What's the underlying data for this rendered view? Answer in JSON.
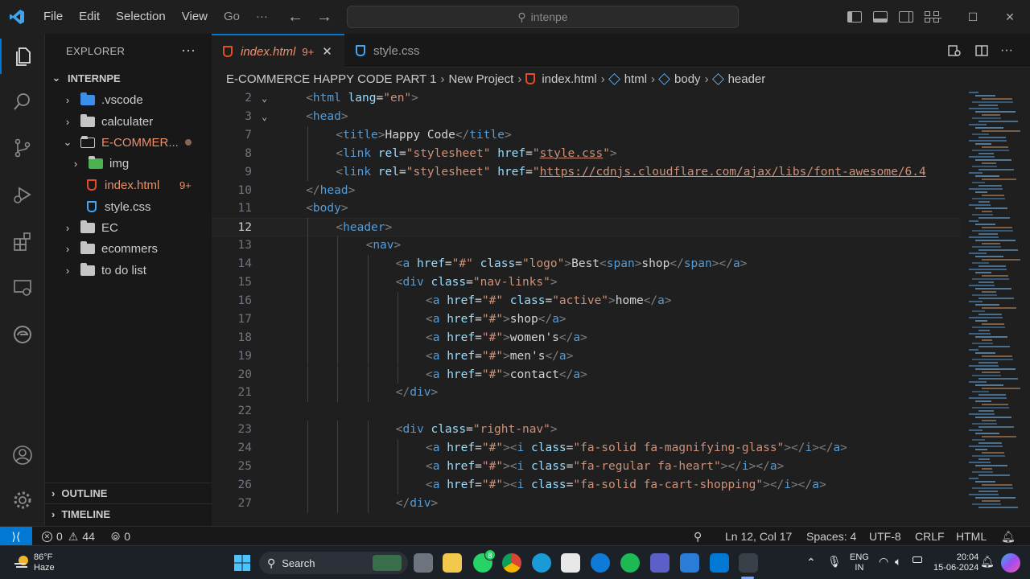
{
  "titlebar": {
    "menu": [
      "File",
      "Edit",
      "Selection",
      "View",
      "Go"
    ],
    "more": "···",
    "search_text": "intenpe"
  },
  "sidebar": {
    "title": "EXPLORER",
    "dots": "···",
    "root": "INTERNPE",
    "items": [
      {
        "label": ".vscode",
        "kind": "folder"
      },
      {
        "label": "calculater",
        "kind": "folder"
      },
      {
        "label": "E-COMMER...",
        "kind": "folder-open"
      },
      {
        "label": "img",
        "kind": "folder"
      },
      {
        "label": "index.html",
        "kind": "html",
        "badge": "9+"
      },
      {
        "label": "style.css",
        "kind": "css"
      },
      {
        "label": "EC",
        "kind": "folder"
      },
      {
        "label": "ecommers",
        "kind": "folder"
      },
      {
        "label": "to do list",
        "kind": "folder"
      }
    ],
    "outline": "OUTLINE",
    "timeline": "TIMELINE"
  },
  "tabs": [
    {
      "label": "index.html",
      "badge": "9+",
      "active": true
    },
    {
      "label": "style.css",
      "active": false
    }
  ],
  "breadcrumb": [
    "E-COMMERCE HAPPY CODE PART 1",
    "New Project",
    "index.html",
    "html",
    "body",
    "header"
  ],
  "editor": {
    "lines": [
      {
        "n": "2",
        "fold": "v",
        "parts": [
          [
            "br",
            "<"
          ],
          [
            "tag",
            "html"
          ],
          [
            "t",
            " "
          ],
          [
            "attr",
            "lang"
          ],
          [
            "t",
            "="
          ],
          [
            "val",
            "\"en\""
          ],
          [
            "br",
            ">"
          ]
        ],
        "indent": 1
      },
      {
        "n": "3",
        "fold": "v",
        "parts": [
          [
            "br",
            "<"
          ],
          [
            "tag",
            "head"
          ],
          [
            "br",
            ">"
          ]
        ],
        "indent": 1
      },
      {
        "n": "7",
        "parts": [
          [
            "br",
            "<"
          ],
          [
            "tag",
            "title"
          ],
          [
            "br",
            ">"
          ],
          [
            "t",
            "Happy Code"
          ],
          [
            "br",
            "</"
          ],
          [
            "tag",
            "title"
          ],
          [
            "br",
            ">"
          ]
        ],
        "indent": 2
      },
      {
        "n": "8",
        "parts": [
          [
            "br",
            "<"
          ],
          [
            "tag",
            "link"
          ],
          [
            "t",
            " "
          ],
          [
            "attr",
            "rel"
          ],
          [
            "t",
            "="
          ],
          [
            "val",
            "\"stylesheet\""
          ],
          [
            "t",
            " "
          ],
          [
            "attr",
            "href"
          ],
          [
            "t",
            "="
          ],
          [
            "val",
            "\""
          ],
          [
            "link",
            "style.css"
          ],
          [
            "val",
            "\""
          ],
          [
            "br",
            ">"
          ]
        ],
        "indent": 2
      },
      {
        "n": "9",
        "parts": [
          [
            "br",
            "<"
          ],
          [
            "tag",
            "link"
          ],
          [
            "t",
            " "
          ],
          [
            "attr",
            "rel"
          ],
          [
            "t",
            "="
          ],
          [
            "val",
            "\"stylesheet\""
          ],
          [
            "t",
            " "
          ],
          [
            "attr",
            "href"
          ],
          [
            "t",
            "="
          ],
          [
            "val",
            "\""
          ],
          [
            "link",
            "https://cdnjs.cloudflare.com/ajax/libs/font-awesome/6.4"
          ]
        ],
        "indent": 2
      },
      {
        "n": "10",
        "parts": [
          [
            "br",
            "</"
          ],
          [
            "tag",
            "head"
          ],
          [
            "br",
            ">"
          ]
        ],
        "indent": 1
      },
      {
        "n": "11",
        "parts": [
          [
            "br",
            "<"
          ],
          [
            "tag",
            "body"
          ],
          [
            "br",
            ">"
          ]
        ],
        "indent": 1
      },
      {
        "n": "12",
        "parts": [
          [
            "br",
            "<"
          ],
          [
            "tag",
            "header"
          ],
          [
            "br",
            ">"
          ]
        ],
        "indent": 2,
        "current": true
      },
      {
        "n": "13",
        "parts": [
          [
            "br",
            "<"
          ],
          [
            "tag",
            "nav"
          ],
          [
            "br",
            ">"
          ]
        ],
        "indent": 3
      },
      {
        "n": "14",
        "parts": [
          [
            "br",
            "<"
          ],
          [
            "tag",
            "a"
          ],
          [
            "t",
            " "
          ],
          [
            "attr",
            "href"
          ],
          [
            "t",
            "="
          ],
          [
            "val",
            "\"#\""
          ],
          [
            "t",
            " "
          ],
          [
            "attr",
            "class"
          ],
          [
            "t",
            "="
          ],
          [
            "val",
            "\"logo\""
          ],
          [
            "br",
            ">"
          ],
          [
            "t",
            "Best"
          ],
          [
            "br",
            "<"
          ],
          [
            "tag",
            "span"
          ],
          [
            "br",
            ">"
          ],
          [
            "t",
            "shop"
          ],
          [
            "br",
            "</"
          ],
          [
            "tag",
            "span"
          ],
          [
            "br",
            "></"
          ],
          [
            "tag",
            "a"
          ],
          [
            "br",
            ">"
          ]
        ],
        "indent": 4
      },
      {
        "n": "15",
        "parts": [
          [
            "br",
            "<"
          ],
          [
            "tag",
            "div"
          ],
          [
            "t",
            " "
          ],
          [
            "attr",
            "class"
          ],
          [
            "t",
            "="
          ],
          [
            "val",
            "\"nav-links\""
          ],
          [
            "br",
            ">"
          ]
        ],
        "indent": 4
      },
      {
        "n": "16",
        "parts": [
          [
            "br",
            "<"
          ],
          [
            "tag",
            "a"
          ],
          [
            "t",
            " "
          ],
          [
            "attr",
            "href"
          ],
          [
            "t",
            "="
          ],
          [
            "val",
            "\"#\""
          ],
          [
            "t",
            " "
          ],
          [
            "attr",
            "class"
          ],
          [
            "t",
            "="
          ],
          [
            "val",
            "\"active\""
          ],
          [
            "br",
            ">"
          ],
          [
            "t",
            "home"
          ],
          [
            "br",
            "</"
          ],
          [
            "tag",
            "a"
          ],
          [
            "br",
            ">"
          ]
        ],
        "indent": 5
      },
      {
        "n": "17",
        "parts": [
          [
            "br",
            "<"
          ],
          [
            "tag",
            "a"
          ],
          [
            "t",
            " "
          ],
          [
            "attr",
            "href"
          ],
          [
            "t",
            "="
          ],
          [
            "val",
            "\"#\""
          ],
          [
            "br",
            ">"
          ],
          [
            "t",
            "shop"
          ],
          [
            "br",
            "</"
          ],
          [
            "tag",
            "a"
          ],
          [
            "br",
            ">"
          ]
        ],
        "indent": 5
      },
      {
        "n": "18",
        "parts": [
          [
            "br",
            "<"
          ],
          [
            "tag",
            "a"
          ],
          [
            "t",
            " "
          ],
          [
            "attr",
            "href"
          ],
          [
            "t",
            "="
          ],
          [
            "val",
            "\"#\""
          ],
          [
            "br",
            ">"
          ],
          [
            "t",
            "women's"
          ],
          [
            "br",
            "</"
          ],
          [
            "tag",
            "a"
          ],
          [
            "br",
            ">"
          ]
        ],
        "indent": 5
      },
      {
        "n": "19",
        "parts": [
          [
            "br",
            "<"
          ],
          [
            "tag",
            "a"
          ],
          [
            "t",
            " "
          ],
          [
            "attr",
            "href"
          ],
          [
            "t",
            "="
          ],
          [
            "val",
            "\"#\""
          ],
          [
            "br",
            ">"
          ],
          [
            "t",
            "men's"
          ],
          [
            "br",
            "</"
          ],
          [
            "tag",
            "a"
          ],
          [
            "br",
            ">"
          ]
        ],
        "indent": 5
      },
      {
        "n": "20",
        "parts": [
          [
            "br",
            "<"
          ],
          [
            "tag",
            "a"
          ],
          [
            "t",
            " "
          ],
          [
            "attr",
            "href"
          ],
          [
            "t",
            "="
          ],
          [
            "val",
            "\"#\""
          ],
          [
            "br",
            ">"
          ],
          [
            "t",
            "contact"
          ],
          [
            "br",
            "</"
          ],
          [
            "tag",
            "a"
          ],
          [
            "br",
            ">"
          ]
        ],
        "indent": 5
      },
      {
        "n": "21",
        "parts": [
          [
            "br",
            "</"
          ],
          [
            "tag",
            "div"
          ],
          [
            "br",
            ">"
          ]
        ],
        "indent": 4
      },
      {
        "n": "22",
        "parts": [],
        "indent": 0
      },
      {
        "n": "23",
        "parts": [
          [
            "br",
            "<"
          ],
          [
            "tag",
            "div"
          ],
          [
            "t",
            " "
          ],
          [
            "attr",
            "class"
          ],
          [
            "t",
            "="
          ],
          [
            "val",
            "\"right-nav\""
          ],
          [
            "br",
            ">"
          ]
        ],
        "indent": 4
      },
      {
        "n": "24",
        "parts": [
          [
            "br",
            "<"
          ],
          [
            "tag",
            "a"
          ],
          [
            "t",
            " "
          ],
          [
            "attr",
            "href"
          ],
          [
            "t",
            "="
          ],
          [
            "val",
            "\"#\""
          ],
          [
            "br",
            "><"
          ],
          [
            "tag",
            "i"
          ],
          [
            "t",
            " "
          ],
          [
            "attr",
            "class"
          ],
          [
            "t",
            "="
          ],
          [
            "val",
            "\"fa-solid fa-magnifying-glass\""
          ],
          [
            "br",
            "></"
          ],
          [
            "tag",
            "i"
          ],
          [
            "br",
            "></"
          ],
          [
            "tag",
            "a"
          ],
          [
            "br",
            ">"
          ]
        ],
        "indent": 5
      },
      {
        "n": "25",
        "parts": [
          [
            "br",
            "<"
          ],
          [
            "tag",
            "a"
          ],
          [
            "t",
            " "
          ],
          [
            "attr",
            "href"
          ],
          [
            "t",
            "="
          ],
          [
            "val",
            "\"#\""
          ],
          [
            "br",
            "><"
          ],
          [
            "tag",
            "i"
          ],
          [
            "t",
            " "
          ],
          [
            "attr",
            "class"
          ],
          [
            "t",
            "="
          ],
          [
            "val",
            "\"fa-regular fa-heart\""
          ],
          [
            "br",
            "></"
          ],
          [
            "tag",
            "i"
          ],
          [
            "br",
            "></"
          ],
          [
            "tag",
            "a"
          ],
          [
            "br",
            ">"
          ]
        ],
        "indent": 5
      },
      {
        "n": "26",
        "parts": [
          [
            "br",
            "<"
          ],
          [
            "tag",
            "a"
          ],
          [
            "t",
            " "
          ],
          [
            "attr",
            "href"
          ],
          [
            "t",
            "="
          ],
          [
            "val",
            "\"#\""
          ],
          [
            "br",
            "><"
          ],
          [
            "tag",
            "i"
          ],
          [
            "t",
            " "
          ],
          [
            "attr",
            "class"
          ],
          [
            "t",
            "="
          ],
          [
            "val",
            "\"fa-solid fa-cart-shopping\""
          ],
          [
            "br",
            "></"
          ],
          [
            "tag",
            "i"
          ],
          [
            "br",
            "></"
          ],
          [
            "tag",
            "a"
          ],
          [
            "br",
            ">"
          ]
        ],
        "indent": 5
      },
      {
        "n": "27",
        "parts": [
          [
            "br",
            "</"
          ],
          [
            "tag",
            "div"
          ],
          [
            "br",
            ">"
          ]
        ],
        "indent": 4
      }
    ]
  },
  "statusbar": {
    "errors": "0",
    "warnings": "44",
    "ports": "0",
    "position": "Ln 12, Col 17",
    "spaces": "Spaces: 4",
    "encoding": "UTF-8",
    "eol": "CRLF",
    "language": "HTML"
  },
  "taskbar": {
    "weather_temp": "86°F",
    "weather_desc": "Haze",
    "search": "Search",
    "lang": "ENG",
    "region": "IN",
    "time": "20:04",
    "date": "15-06-2024",
    "badge": "8"
  },
  "colors": {
    "accent": "#0078d4",
    "tag": "#569cd6",
    "attr": "#9cdcfe",
    "string": "#ce9178",
    "html_icon": "#e44d26",
    "css_icon": "#42a5f5",
    "modified": "#e8916e"
  }
}
